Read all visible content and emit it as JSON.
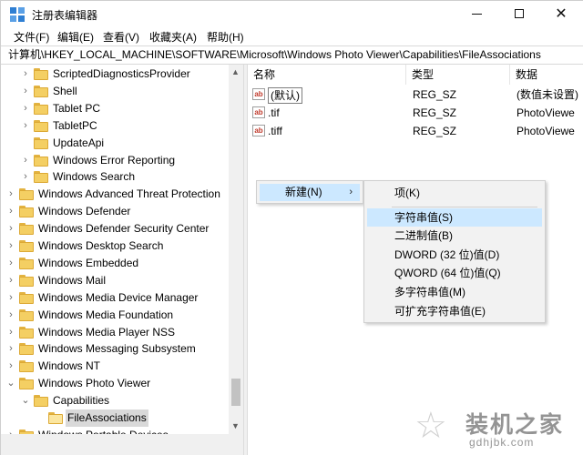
{
  "window": {
    "title": "注册表编辑器",
    "controls": {
      "minimize": "minimize",
      "maximize": "maximize",
      "close": "✕"
    }
  },
  "menu": [
    "文件(F)",
    "编辑(E)",
    "查看(V)",
    "收藏夹(A)",
    "帮助(H)"
  ],
  "address": "计算机\\HKEY_LOCAL_MACHINE\\SOFTWARE\\Microsoft\\Windows Photo Viewer\\Capabilities\\FileAssociations",
  "tree": {
    "items": [
      {
        "label": "ScriptedDiagnosticsProvider",
        "level": 2,
        "expander": "collapsed"
      },
      {
        "label": "Shell",
        "level": 2,
        "expander": "collapsed"
      },
      {
        "label": "Tablet PC",
        "level": 2,
        "expander": "collapsed"
      },
      {
        "label": "TabletPC",
        "level": 2,
        "expander": "collapsed"
      },
      {
        "label": "UpdateApi",
        "level": 2,
        "expander": "none"
      },
      {
        "label": "Windows Error Reporting",
        "level": 2,
        "expander": "collapsed"
      },
      {
        "label": "Windows Search",
        "level": 2,
        "expander": "collapsed"
      },
      {
        "label": "Windows Advanced Threat Protection",
        "level": 1,
        "expander": "collapsed"
      },
      {
        "label": "Windows Defender",
        "level": 1,
        "expander": "collapsed"
      },
      {
        "label": "Windows Defender Security Center",
        "level": 1,
        "expander": "collapsed"
      },
      {
        "label": "Windows Desktop Search",
        "level": 1,
        "expander": "collapsed"
      },
      {
        "label": "Windows Embedded",
        "level": 1,
        "expander": "collapsed"
      },
      {
        "label": "Windows Mail",
        "level": 1,
        "expander": "collapsed"
      },
      {
        "label": "Windows Media Device Manager",
        "level": 1,
        "expander": "collapsed"
      },
      {
        "label": "Windows Media Foundation",
        "level": 1,
        "expander": "collapsed"
      },
      {
        "label": "Windows Media Player NSS",
        "level": 1,
        "expander": "collapsed"
      },
      {
        "label": "Windows Messaging Subsystem",
        "level": 1,
        "expander": "collapsed"
      },
      {
        "label": "Windows NT",
        "level": 1,
        "expander": "collapsed"
      },
      {
        "label": "Windows Photo Viewer",
        "level": 1,
        "expander": "expanded"
      },
      {
        "label": "Capabilities",
        "level": 2,
        "expander": "expanded"
      },
      {
        "label": "FileAssociations",
        "level": 3,
        "expander": "none",
        "selected": true
      },
      {
        "label": "Windows Portable Devices",
        "level": 1,
        "expander": "collapsed"
      }
    ]
  },
  "values": {
    "headers": {
      "name": "名称",
      "type": "类型",
      "data": "数据"
    },
    "rows": [
      {
        "name": "(默认)",
        "type": "REG_SZ",
        "data": "(数值未设置)",
        "icon": "string-value-icon"
      },
      {
        "name": ".tif",
        "type": "REG_SZ",
        "data": "PhotoViewe",
        "icon": "string-value-icon"
      },
      {
        "name": ".tiff",
        "type": "REG_SZ",
        "data": "PhotoViewe",
        "icon": "string-value-icon"
      }
    ]
  },
  "context_menu": {
    "new_label": "新建(N)",
    "submenu": [
      {
        "label": "项(K)"
      },
      {
        "label": "字符串值(S)",
        "highlighted": true
      },
      {
        "label": "二进制值(B)"
      },
      {
        "label": "DWORD (32 位)值(D)"
      },
      {
        "label": "QWORD (64 位)值(Q)"
      },
      {
        "label": "多字符串值(M)"
      },
      {
        "label": "可扩充字符串值(E)"
      }
    ]
  },
  "watermark": {
    "title": "装机之家",
    "url": "gdhjbk.com"
  },
  "colors": {
    "highlight": "#cce8ff",
    "folder": "#f4cf63",
    "selection": "#d9d9d9"
  }
}
